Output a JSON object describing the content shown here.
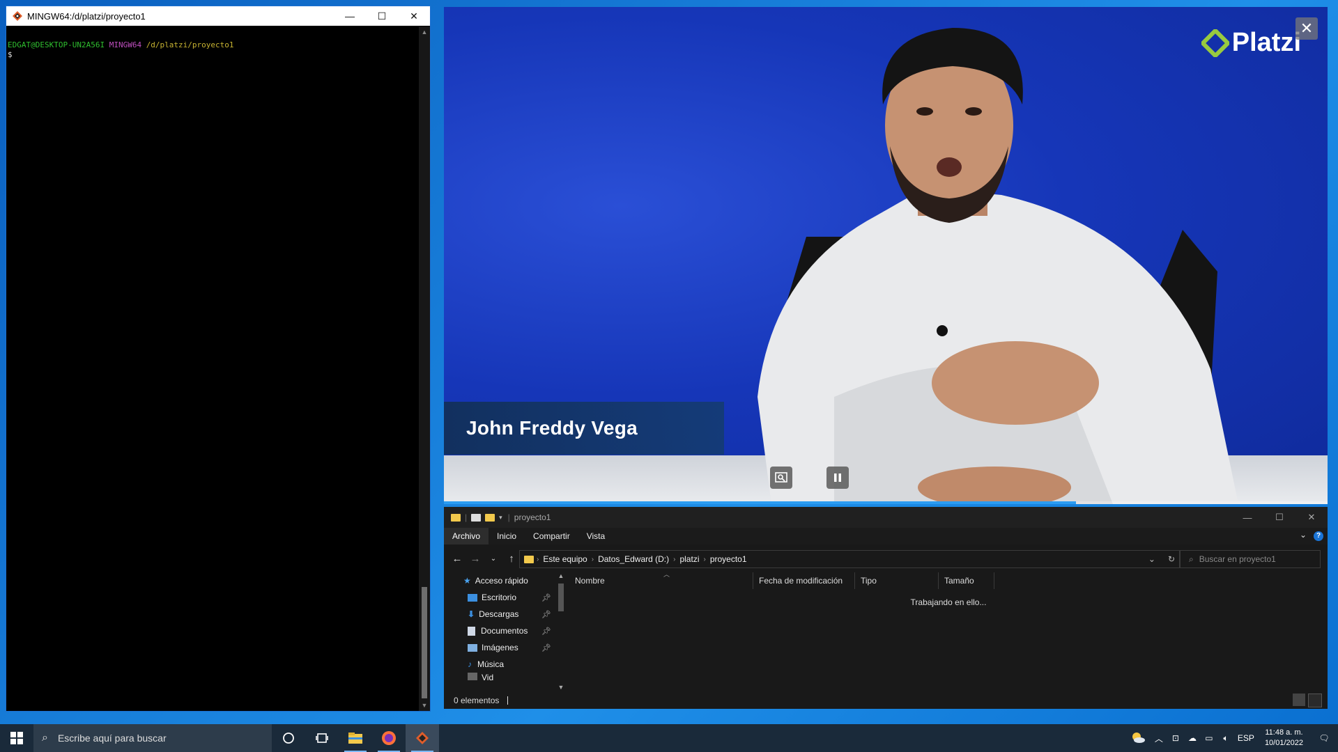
{
  "terminal": {
    "title": "MINGW64:/d/platzi/proyecto1",
    "prompt_user": "EDGAT@DESKTOP-UN2A56I",
    "prompt_system": "MINGW64",
    "prompt_path": "/d/platzi/proyecto1",
    "prompt_symbol": "$"
  },
  "video": {
    "brand": "Platzi",
    "presenter_name": "John Freddy Vega",
    "progress": 0.715
  },
  "explorer": {
    "title": "proyecto1",
    "ribbon_tabs": [
      "Archivo",
      "Inicio",
      "Compartir",
      "Vista"
    ],
    "breadcrumb": [
      "Este equipo",
      "Datos_Edward (D:)",
      "platzi",
      "proyecto1"
    ],
    "search_placeholder": "Buscar en proyecto1",
    "nav_items": [
      {
        "label": "Acceso rápido",
        "pinned": false
      },
      {
        "label": "Escritorio",
        "pinned": true
      },
      {
        "label": "Descargas",
        "pinned": true
      },
      {
        "label": "Documentos",
        "pinned": true
      },
      {
        "label": "Imágenes",
        "pinned": true
      },
      {
        "label": "Música",
        "pinned": false
      },
      {
        "label": "Vid",
        "pinned": false
      }
    ],
    "columns": [
      "Nombre",
      "Fecha de modificación",
      "Tipo",
      "Tamaño"
    ],
    "status_message": "Trabajando en ello...",
    "item_count": "0 elementos",
    "help": "?"
  },
  "taskbar": {
    "search_placeholder": "Escribe aquí para buscar",
    "language": "ESP",
    "time": "11:48 a. m.",
    "date": "10/01/2022"
  },
  "colors": {
    "desktop": "#1f8fe8",
    "accent": "#2b9cf2",
    "platzi_green": "#98ca3f"
  }
}
